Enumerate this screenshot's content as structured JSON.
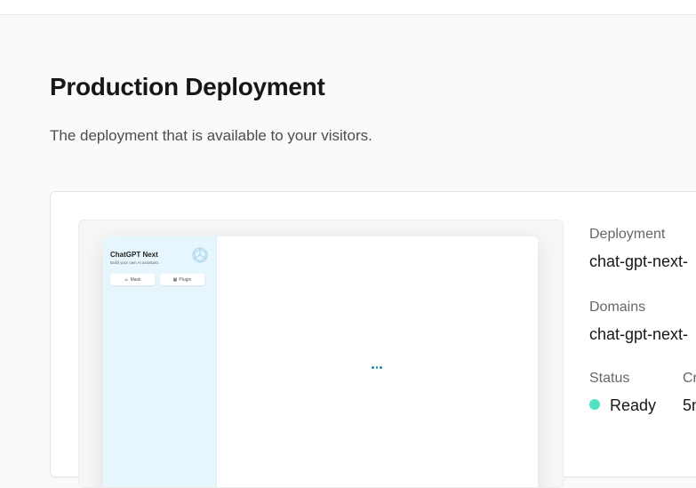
{
  "header": {
    "title": "Production Deployment",
    "subtitle": "The deployment that is available to your visitors."
  },
  "preview": {
    "app_title": "ChatGPT Next",
    "app_subtitle": "Build your own AI assistant.",
    "buttons": [
      {
        "label": "Mask",
        "icon": "mask-icon"
      },
      {
        "label": "Plugin",
        "icon": "plugin-icon"
      }
    ],
    "logo_icon": "openai-logo-icon",
    "loading_icon": "loading-dots-icon"
  },
  "info": {
    "deployment_label": "Deployment",
    "deployment_value": "chat-gpt-next-",
    "domains_label": "Domains",
    "domains_value": "chat-gpt-next-",
    "status_label": "Status",
    "status_value": "Ready",
    "status_color": "#50e3c2",
    "created_label": "Cr",
    "created_value": "5n"
  },
  "colors": {
    "accent": "#1d93ab",
    "sidebar_bg": "#e7f6fd",
    "ready": "#50e3c2"
  }
}
